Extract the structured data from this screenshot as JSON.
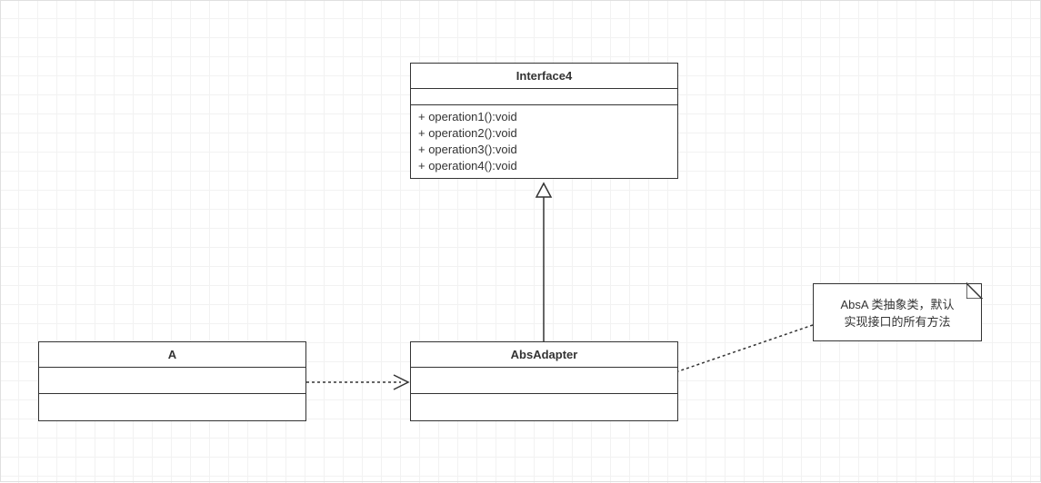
{
  "interface": {
    "name": "Interface4",
    "operations": [
      "+ operation1():void",
      "+ operation2():void",
      "+ operation3():void",
      "+ operation4():void"
    ]
  },
  "classA": {
    "name": "A"
  },
  "absAdapter": {
    "name": "AbsAdapter"
  },
  "note": {
    "line1": "AbsA 类抽象类，默认",
    "line2": "实现接口的所有方法"
  }
}
